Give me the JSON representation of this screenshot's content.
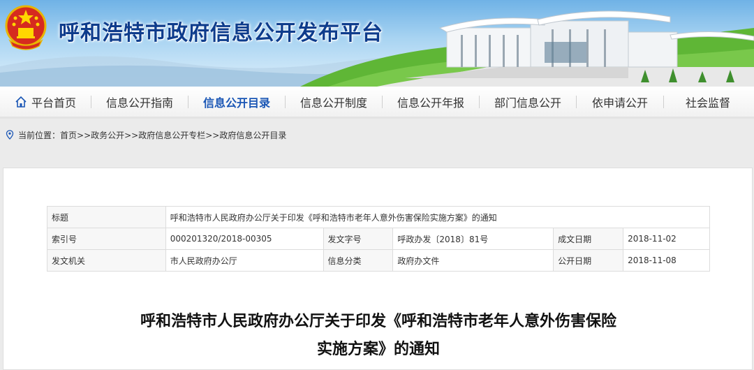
{
  "header": {
    "site_title": "呼和浩特市政府信息公开发布平台",
    "emblem": "national-emblem"
  },
  "nav": {
    "items": [
      {
        "label": "平台首页",
        "icon": "home-icon"
      },
      {
        "label": "信息公开指南"
      },
      {
        "label": "信息公开目录",
        "active": true
      },
      {
        "label": "信息公开制度"
      },
      {
        "label": "信息公开年报"
      },
      {
        "label": "部门信息公开"
      },
      {
        "label": "依申请公开"
      },
      {
        "label": "社会监督"
      }
    ]
  },
  "breadcrumb": {
    "prefix": "当前位置：",
    "path": "首页>>政务公开>>政府信息公开专栏>>政府信息公开目录"
  },
  "meta": {
    "title_label": "标题",
    "title_value": "呼和浩特市人民政府办公厅关于印发《呼和浩特市老年人意外伤害保险实施方案》的通知",
    "index_label": "索引号",
    "index_value": "000201320/2018-00305",
    "docno_label": "发文字号",
    "docno_value": "呼政办发〔2018〕81号",
    "created_label": "成文日期",
    "created_value": "2018-11-02",
    "issuer_label": "发文机关",
    "issuer_value": "市人民政府办公厅",
    "category_label": "信息分类",
    "category_value": "政府办文件",
    "published_label": "公开日期",
    "published_value": "2018-11-08"
  },
  "document": {
    "title_line1": "呼和浩特市人民政府办公厅关于印发《呼和浩特市老年人意外伤害保险",
    "title_line2": "实施方案》的通知"
  },
  "colors": {
    "title_blue": "#0e3c8c",
    "nav_active": "#1a56b5",
    "grass": "#5fb636"
  }
}
